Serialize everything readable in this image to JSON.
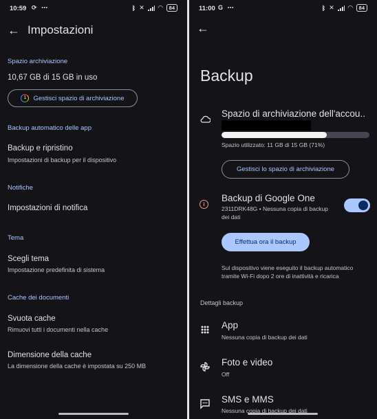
{
  "left": {
    "status": {
      "time": "10:59",
      "battery": "84"
    },
    "title": "Impostazioni",
    "storage": {
      "section": "Spazio archiviazione",
      "usage": "10,67 GB di 15 GB in uso",
      "button": "Gestisci spazio di archiviazione",
      "button_icon_text": "1"
    },
    "backup_section": "Backup automatico delle app",
    "backup_item": {
      "title": "Backup e ripristino",
      "subtitle": "Impostazioni di backup per il dispositivo"
    },
    "notif_section": "Notifiche",
    "notif_item": {
      "title": "Impostazioni di notifica"
    },
    "theme_section": "Tema",
    "theme_item": {
      "title": "Scegli tema",
      "subtitle": "Impostazione predefinita di sistema"
    },
    "cache_section": "Cache dei documenti",
    "clear_cache": {
      "title": "Svuota cache",
      "subtitle": "Rimuovi tutti i documenti nella cache"
    },
    "cache_size": {
      "title": "Dimensione della cache",
      "subtitle": "La dimensione della cache è impostata su 250 MB"
    }
  },
  "right": {
    "status": {
      "time": "11:00",
      "carrier_icon": "G",
      "battery": "84"
    },
    "title": "Backup",
    "storage": {
      "title": "Spazio di archiviazione dell'accou..",
      "used_fraction": 0.71,
      "usage_text": "Spazio utilizzato: 11 GB di 15 GB (71%)",
      "button": "Gestisci lo spazio di archiviazione"
    },
    "google_one": {
      "title": "Backup di Google One",
      "subtitle": "2311DRK48G • Nessuna copia di backup dei dati",
      "toggle_on": true
    },
    "backup_now": "Effettua ora il backup",
    "info_text": "Sul dispositivo viene eseguito il backup automatico tramite Wi-Fi dopo 2 ore di inattività e ricarica",
    "details_section": "Dettagli backup",
    "details": [
      {
        "icon": "apps-grid-icon",
        "title": "App",
        "subtitle": "Nessuna copia di backup dei dati"
      },
      {
        "icon": "pinwheel-icon",
        "title": "Foto e video",
        "subtitle": "Off"
      },
      {
        "icon": "message-icon",
        "title": "SMS e MMS",
        "subtitle": "Nessuna copia di backup dei dati"
      }
    ]
  }
}
